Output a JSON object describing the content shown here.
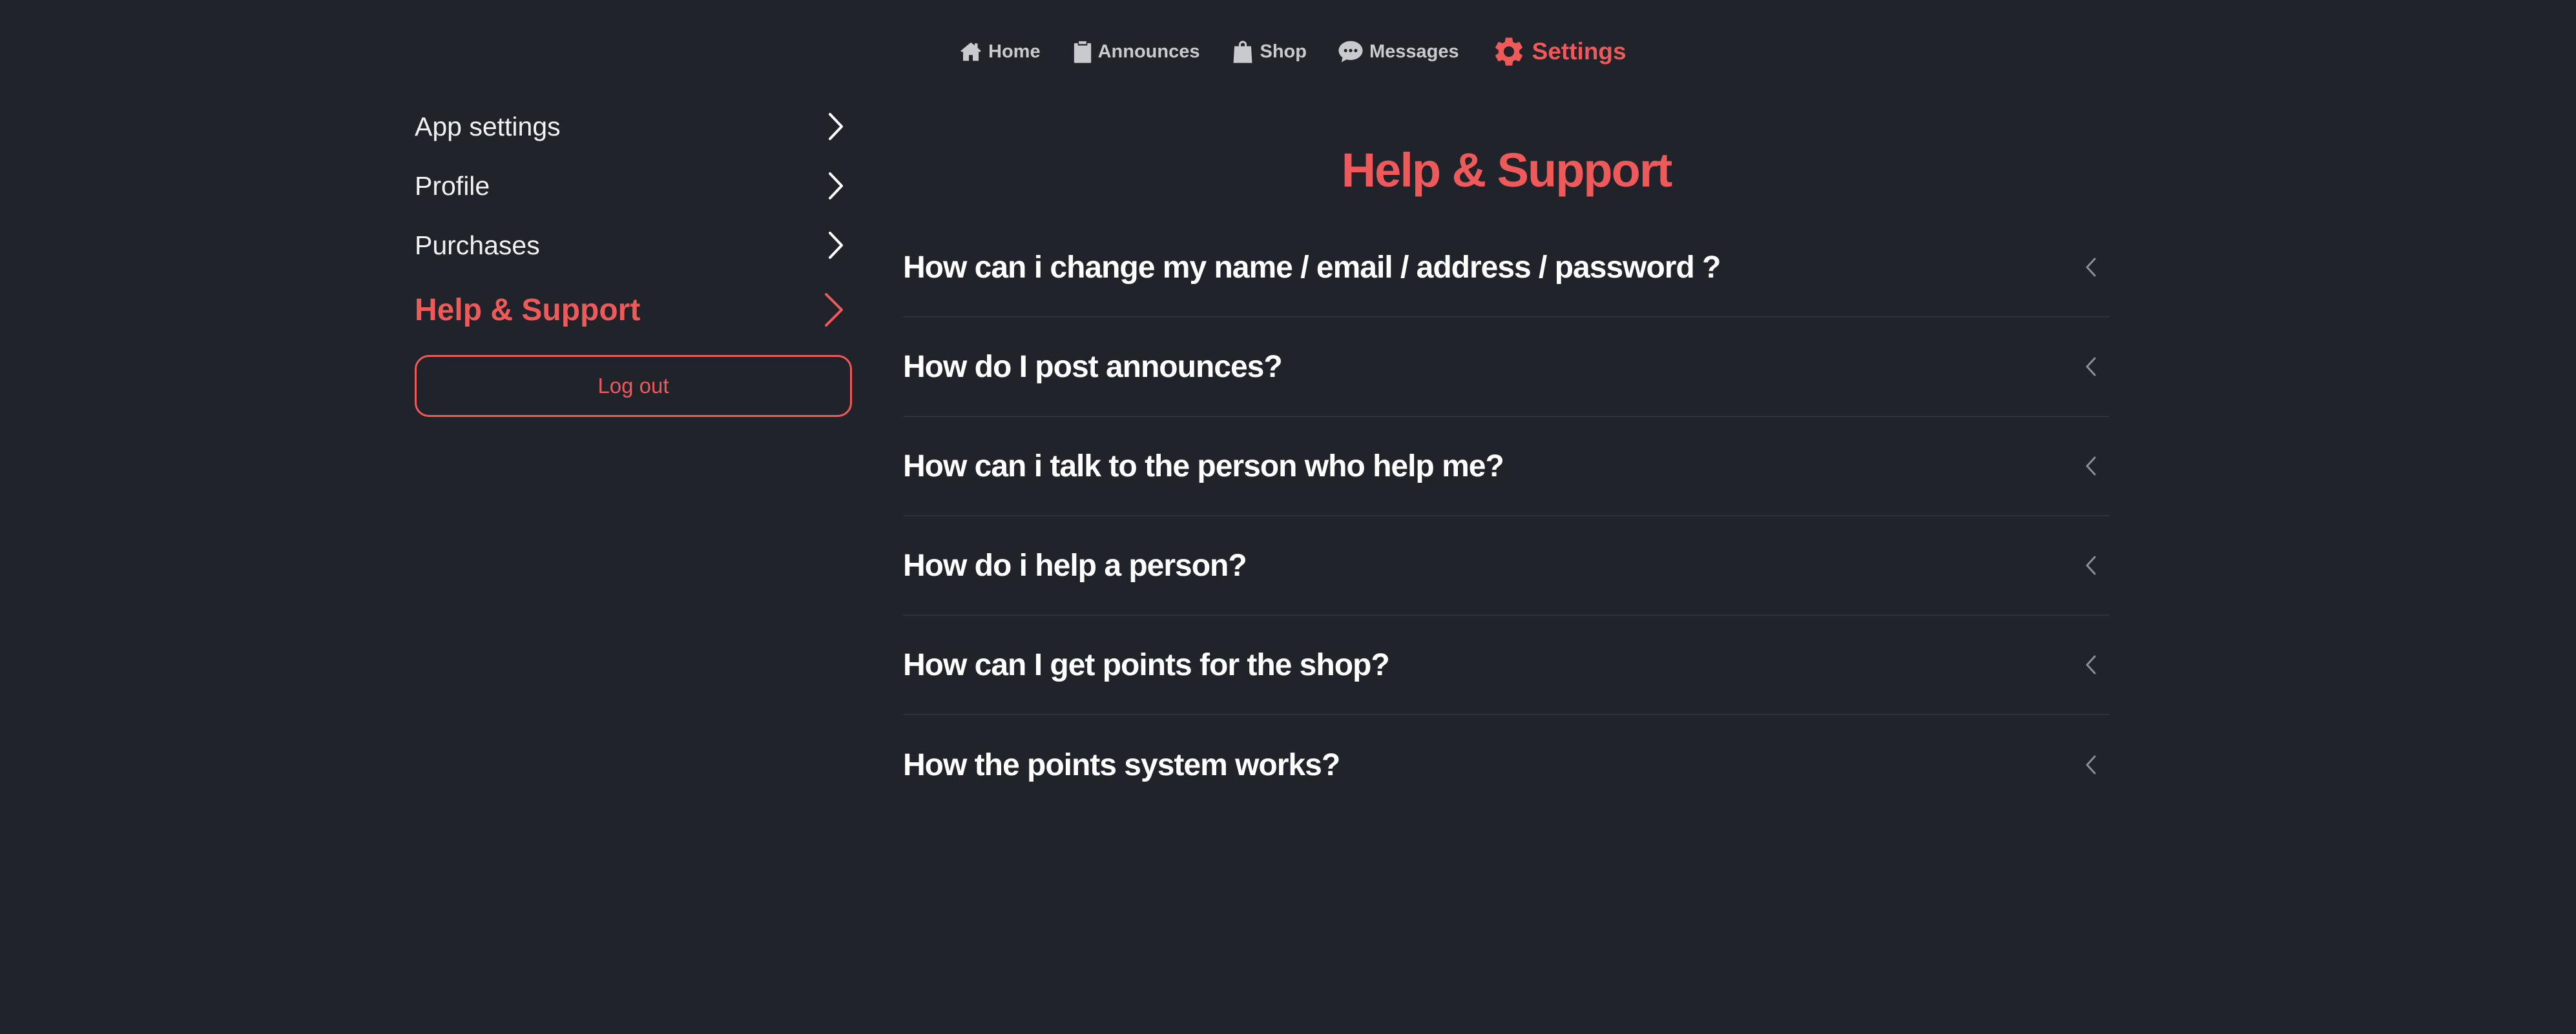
{
  "nav": {
    "items": [
      {
        "label": "Home",
        "icon": "home-icon"
      },
      {
        "label": "Announces",
        "icon": "clipboard-icon"
      },
      {
        "label": "Shop",
        "icon": "shopping-bag-icon"
      },
      {
        "label": "Messages",
        "icon": "chat-bubble-icon"
      },
      {
        "label": "Settings",
        "icon": "gear-icon",
        "active": true
      }
    ]
  },
  "sidebar": {
    "items": [
      {
        "label": "App settings"
      },
      {
        "label": "Profile"
      },
      {
        "label": "Purchases"
      },
      {
        "label": "Help & Support",
        "active": true
      }
    ],
    "logout_label": "Log out"
  },
  "main": {
    "title": "Help & Support",
    "faq": [
      {
        "question": "How can i change my name / email / address / password ?"
      },
      {
        "question": "How do I post announces?"
      },
      {
        "question": "How can i talk to the person who help me?"
      },
      {
        "question": "How do i help a person?"
      },
      {
        "question": "How can I get points for the shop?"
      },
      {
        "question": "How the points system works?"
      }
    ]
  },
  "colors": {
    "background": "#21232a",
    "accent": "#ee5a5a",
    "text": "#ffffff",
    "muted": "#c9cacd"
  }
}
